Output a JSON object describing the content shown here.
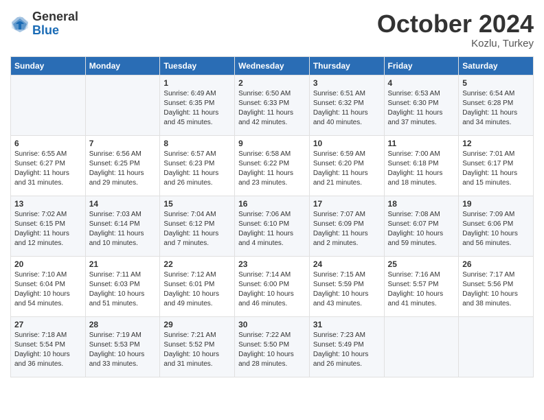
{
  "logo": {
    "general": "General",
    "blue": "Blue"
  },
  "header": {
    "month": "October 2024",
    "location": "Kozlu, Turkey"
  },
  "days_of_week": [
    "Sunday",
    "Monday",
    "Tuesday",
    "Wednesday",
    "Thursday",
    "Friday",
    "Saturday"
  ],
  "weeks": [
    [
      {
        "day": "",
        "info": ""
      },
      {
        "day": "",
        "info": ""
      },
      {
        "day": "1",
        "info": "Sunrise: 6:49 AM\nSunset: 6:35 PM\nDaylight: 11 hours and 45 minutes."
      },
      {
        "day": "2",
        "info": "Sunrise: 6:50 AM\nSunset: 6:33 PM\nDaylight: 11 hours and 42 minutes."
      },
      {
        "day": "3",
        "info": "Sunrise: 6:51 AM\nSunset: 6:32 PM\nDaylight: 11 hours and 40 minutes."
      },
      {
        "day": "4",
        "info": "Sunrise: 6:53 AM\nSunset: 6:30 PM\nDaylight: 11 hours and 37 minutes."
      },
      {
        "day": "5",
        "info": "Sunrise: 6:54 AM\nSunset: 6:28 PM\nDaylight: 11 hours and 34 minutes."
      }
    ],
    [
      {
        "day": "6",
        "info": "Sunrise: 6:55 AM\nSunset: 6:27 PM\nDaylight: 11 hours and 31 minutes."
      },
      {
        "day": "7",
        "info": "Sunrise: 6:56 AM\nSunset: 6:25 PM\nDaylight: 11 hours and 29 minutes."
      },
      {
        "day": "8",
        "info": "Sunrise: 6:57 AM\nSunset: 6:23 PM\nDaylight: 11 hours and 26 minutes."
      },
      {
        "day": "9",
        "info": "Sunrise: 6:58 AM\nSunset: 6:22 PM\nDaylight: 11 hours and 23 minutes."
      },
      {
        "day": "10",
        "info": "Sunrise: 6:59 AM\nSunset: 6:20 PM\nDaylight: 11 hours and 21 minutes."
      },
      {
        "day": "11",
        "info": "Sunrise: 7:00 AM\nSunset: 6:18 PM\nDaylight: 11 hours and 18 minutes."
      },
      {
        "day": "12",
        "info": "Sunrise: 7:01 AM\nSunset: 6:17 PM\nDaylight: 11 hours and 15 minutes."
      }
    ],
    [
      {
        "day": "13",
        "info": "Sunrise: 7:02 AM\nSunset: 6:15 PM\nDaylight: 11 hours and 12 minutes."
      },
      {
        "day": "14",
        "info": "Sunrise: 7:03 AM\nSunset: 6:14 PM\nDaylight: 11 hours and 10 minutes."
      },
      {
        "day": "15",
        "info": "Sunrise: 7:04 AM\nSunset: 6:12 PM\nDaylight: 11 hours and 7 minutes."
      },
      {
        "day": "16",
        "info": "Sunrise: 7:06 AM\nSunset: 6:10 PM\nDaylight: 11 hours and 4 minutes."
      },
      {
        "day": "17",
        "info": "Sunrise: 7:07 AM\nSunset: 6:09 PM\nDaylight: 11 hours and 2 minutes."
      },
      {
        "day": "18",
        "info": "Sunrise: 7:08 AM\nSunset: 6:07 PM\nDaylight: 10 hours and 59 minutes."
      },
      {
        "day": "19",
        "info": "Sunrise: 7:09 AM\nSunset: 6:06 PM\nDaylight: 10 hours and 56 minutes."
      }
    ],
    [
      {
        "day": "20",
        "info": "Sunrise: 7:10 AM\nSunset: 6:04 PM\nDaylight: 10 hours and 54 minutes."
      },
      {
        "day": "21",
        "info": "Sunrise: 7:11 AM\nSunset: 6:03 PM\nDaylight: 10 hours and 51 minutes."
      },
      {
        "day": "22",
        "info": "Sunrise: 7:12 AM\nSunset: 6:01 PM\nDaylight: 10 hours and 49 minutes."
      },
      {
        "day": "23",
        "info": "Sunrise: 7:14 AM\nSunset: 6:00 PM\nDaylight: 10 hours and 46 minutes."
      },
      {
        "day": "24",
        "info": "Sunrise: 7:15 AM\nSunset: 5:59 PM\nDaylight: 10 hours and 43 minutes."
      },
      {
        "day": "25",
        "info": "Sunrise: 7:16 AM\nSunset: 5:57 PM\nDaylight: 10 hours and 41 minutes."
      },
      {
        "day": "26",
        "info": "Sunrise: 7:17 AM\nSunset: 5:56 PM\nDaylight: 10 hours and 38 minutes."
      }
    ],
    [
      {
        "day": "27",
        "info": "Sunrise: 7:18 AM\nSunset: 5:54 PM\nDaylight: 10 hours and 36 minutes."
      },
      {
        "day": "28",
        "info": "Sunrise: 7:19 AM\nSunset: 5:53 PM\nDaylight: 10 hours and 33 minutes."
      },
      {
        "day": "29",
        "info": "Sunrise: 7:21 AM\nSunset: 5:52 PM\nDaylight: 10 hours and 31 minutes."
      },
      {
        "day": "30",
        "info": "Sunrise: 7:22 AM\nSunset: 5:50 PM\nDaylight: 10 hours and 28 minutes."
      },
      {
        "day": "31",
        "info": "Sunrise: 7:23 AM\nSunset: 5:49 PM\nDaylight: 10 hours and 26 minutes."
      },
      {
        "day": "",
        "info": ""
      },
      {
        "day": "",
        "info": ""
      }
    ]
  ]
}
